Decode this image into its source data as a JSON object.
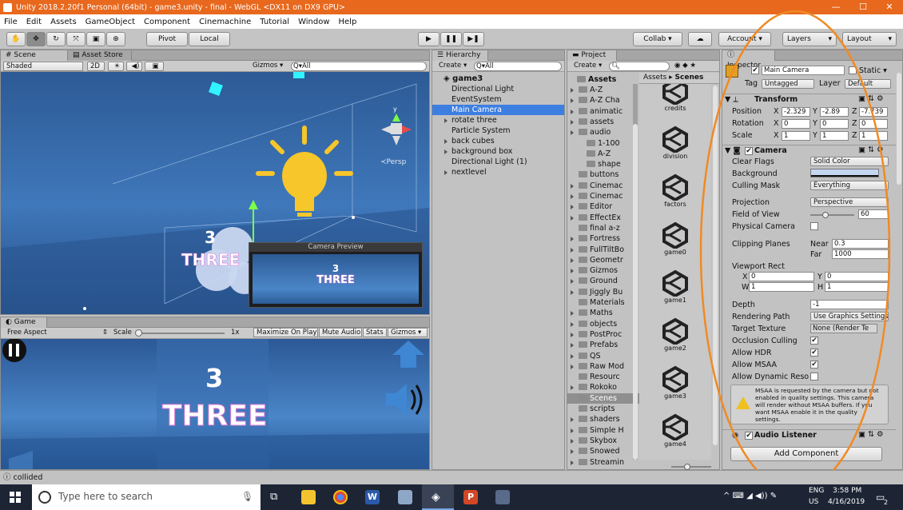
{
  "window": {
    "title": "Unity 2018.2.20f1 Personal (64bit) - game3.unity - final - WebGL <DX11 on DX9 GPU>",
    "controls": [
      "—",
      "☐",
      "✕"
    ]
  },
  "menu": [
    "File",
    "Edit",
    "Assets",
    "GameObject",
    "Component",
    "Cinemachine",
    "Tutorial",
    "Window",
    "Help"
  ],
  "toolbar": {
    "pivot": "Pivot",
    "local": "Local",
    "collab": "Collab ▾",
    "account": "Account ▾",
    "layers": "Layers",
    "layout": "Layout"
  },
  "scene": {
    "tab_scene": "# Scene",
    "tab_store": "Asset Store",
    "shading": "Shaded",
    "mode2d": "2D",
    "gizmos": "Gizmos ▾",
    "search_placeholder": "Q▾All",
    "persp": "≺Persp",
    "text_num": "3",
    "text_word": "THREE",
    "preview_title": "Camera Preview",
    "preview_num": "3",
    "preview_word": "THREE"
  },
  "game": {
    "tab": "Game",
    "aspect": "Free Aspect",
    "scale_label": "Scale",
    "scale_value": "1x",
    "maximize": "Maximize On Play",
    "mute": "Mute Audio",
    "stats": "Stats",
    "gizmos": "Gizmos ▾",
    "text_num": "3",
    "text_word": "THREE"
  },
  "hierarchy": {
    "tab": "Hierarchy",
    "create": "Create ▾",
    "search": "Q▾All",
    "scene": "game3",
    "items": [
      {
        "label": "Directional Light",
        "fold": false,
        "selected": false
      },
      {
        "label": "EventSystem",
        "fold": false,
        "selected": false
      },
      {
        "label": "Main Camera",
        "fold": false,
        "selected": true
      },
      {
        "label": "rotate three",
        "fold": true,
        "selected": false
      },
      {
        "label": "Particle System",
        "fold": false,
        "selected": false
      },
      {
        "label": "back cubes",
        "fold": true,
        "selected": false
      },
      {
        "label": "background box",
        "fold": true,
        "selected": false
      },
      {
        "label": "Directional Light (1)",
        "fold": false,
        "selected": false
      },
      {
        "label": "nextlevel",
        "fold": true,
        "selected": false
      }
    ]
  },
  "project": {
    "tab": "Project",
    "create": "Create ▾",
    "tree_root": "Assets",
    "tree": [
      {
        "label": "A-Z",
        "indent": 1,
        "fold": true
      },
      {
        "label": "A-Z Cha",
        "indent": 1,
        "fold": true
      },
      {
        "label": "animatic",
        "indent": 1,
        "fold": true
      },
      {
        "label": "assets",
        "indent": 1,
        "fold": true
      },
      {
        "label": "audio",
        "indent": 1,
        "fold": true
      },
      {
        "label": "1-100",
        "indent": 2,
        "fold": false
      },
      {
        "label": "A-Z",
        "indent": 2,
        "fold": false
      },
      {
        "label": "shape",
        "indent": 2,
        "fold": false
      },
      {
        "label": "buttons",
        "indent": 1,
        "fold": false
      },
      {
        "label": "Cinemac",
        "indent": 1,
        "fold": true
      },
      {
        "label": "Cinemac",
        "indent": 1,
        "fold": true
      },
      {
        "label": "Editor",
        "indent": 1,
        "fold": true
      },
      {
        "label": "EffectEx",
        "indent": 1,
        "fold": true
      },
      {
        "label": "final a-z",
        "indent": 1,
        "fold": false
      },
      {
        "label": "Fortress",
        "indent": 1,
        "fold": true
      },
      {
        "label": "FullTiltBo",
        "indent": 1,
        "fold": true
      },
      {
        "label": "Geometr",
        "indent": 1,
        "fold": true
      },
      {
        "label": "Gizmos",
        "indent": 1,
        "fold": true
      },
      {
        "label": "Ground",
        "indent": 1,
        "fold": true
      },
      {
        "label": "Jiggly Bu",
        "indent": 1,
        "fold": true
      },
      {
        "label": "Materials",
        "indent": 1,
        "fold": false
      },
      {
        "label": "Maths",
        "indent": 1,
        "fold": true
      },
      {
        "label": "objects",
        "indent": 1,
        "fold": true
      },
      {
        "label": "PostProc",
        "indent": 1,
        "fold": true
      },
      {
        "label": "Prefabs",
        "indent": 1,
        "fold": true
      },
      {
        "label": "QS",
        "indent": 1,
        "fold": true
      },
      {
        "label": "Raw Mod",
        "indent": 1,
        "fold": true
      },
      {
        "label": "Resourc",
        "indent": 1,
        "fold": false
      },
      {
        "label": "Rokoko",
        "indent": 1,
        "fold": true
      },
      {
        "label": "Scenes",
        "indent": 1,
        "fold": false,
        "selected": true
      },
      {
        "label": "scripts",
        "indent": 1,
        "fold": false
      },
      {
        "label": "shaders",
        "indent": 1,
        "fold": true
      },
      {
        "label": "Simple H",
        "indent": 1,
        "fold": true
      },
      {
        "label": "Skybox",
        "indent": 1,
        "fold": true
      },
      {
        "label": "Snowed",
        "indent": 1,
        "fold": true
      },
      {
        "label": "Streamin",
        "indent": 1,
        "fold": true
      }
    ],
    "breadcrumb_a": "Assets",
    "breadcrumb_b": "Scenes",
    "assets": [
      "credits",
      "division",
      "factors",
      "game0",
      "game1",
      "game2",
      "game3",
      "game4"
    ]
  },
  "inspector": {
    "tab": "Inspector",
    "object_name": "Main Camera",
    "static_label": "Static ▾",
    "tag_label": "Tag",
    "tag_value": "Untagged",
    "layer_label": "Layer",
    "layer_value": "Default",
    "transform": {
      "title": "Transform",
      "rows": [
        {
          "label": "Position",
          "x": "-2.329",
          "y": "-2.89",
          "z": "-7.739"
        },
        {
          "label": "Rotation",
          "x": "0",
          "y": "0",
          "z": "0"
        },
        {
          "label": "Scale",
          "x": "1",
          "y": "1",
          "z": "1"
        }
      ]
    },
    "camera": {
      "title": "Camera",
      "clear_flags_label": "Clear Flags",
      "clear_flags_value": "Solid Color",
      "background_label": "Background",
      "culling_label": "Culling Mask",
      "culling_value": "Everything",
      "projection_label": "Projection",
      "projection_value": "Perspective",
      "fov_label": "Field of View",
      "fov_value": "60",
      "fov_fraction": 0.35,
      "physical_label": "Physical Camera",
      "clipping_label": "Clipping Planes",
      "near_label": "Near",
      "near_value": "0.3",
      "far_label": "Far",
      "far_value": "1000",
      "viewport_label": "Viewport Rect",
      "vx": "0",
      "vy": "0",
      "vw": "1",
      "vh": "1",
      "depth_label": "Depth",
      "depth_value": "-1",
      "rendering_label": "Rendering Path",
      "rendering_value": "Use Graphics Settings",
      "target_label": "Target Texture",
      "target_value": "None (Render Te",
      "occlusion_label": "Occlusion Culling",
      "hdr_label": "Allow HDR",
      "msaa_label": "Allow MSAA",
      "dynres_label": "Allow Dynamic Reso",
      "warning": "MSAA is requested by the camera but not enabled in quality settings. This camera will render without MSAA buffers. If you want MSAA enable it in the quality settings."
    },
    "audio_listener": "Audio Listener",
    "add_component": "Add Component"
  },
  "status": {
    "text": "collided"
  },
  "taskbar": {
    "search_placeholder": "Type here to search",
    "lang": "ENG",
    "region": "US",
    "time": "3:58 PM",
    "date": "4/16/2019",
    "notif_count": "2"
  },
  "colors": {
    "title_orange": "#e8681d",
    "selection_blue": "#3d7ee1",
    "scene_blue": "#2f5f9a",
    "annotation_orange": "#f08a24"
  }
}
